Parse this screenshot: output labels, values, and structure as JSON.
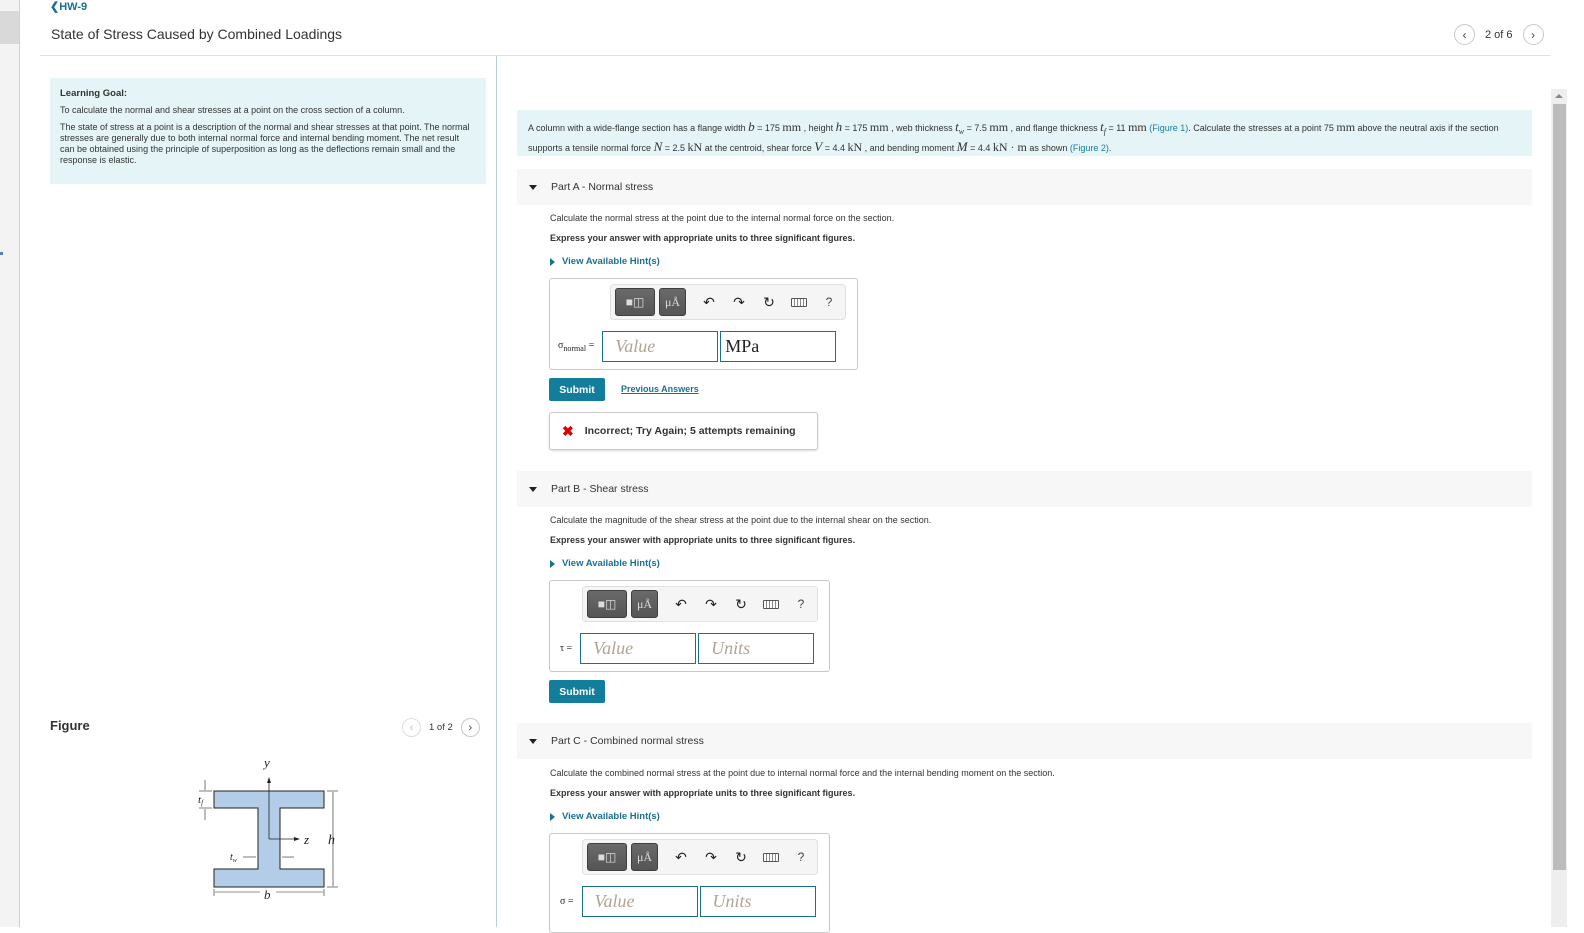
{
  "header": {
    "back_label": "HW-9",
    "title": "State of Stress Caused by Combined Loadings",
    "pager": {
      "text": "2 of 6",
      "prev_icon": "chevron-left-icon",
      "next_icon": "chevron-right-icon"
    }
  },
  "learning_goal": {
    "title": "Learning Goal:",
    "paragraphs": [
      "To calculate the normal and shear stresses at a point on the cross section of a column.",
      "The state of stress at a point is a description of the normal and shear stresses at that point. The normal stresses are generally due to both internal normal force and internal bending moment. The net result can be obtained using the principle of superposition as long as the deflections remain small and the response is elastic."
    ]
  },
  "figure": {
    "title": "Figure",
    "pager_text": "1 of 2",
    "labels": {
      "y": "y",
      "z": "z",
      "h": "h",
      "b": "b",
      "tf": "t",
      "tf_sub": "f",
      "tw": "t",
      "tw_sub": "w"
    },
    "colors": {
      "fill": "#b3cde8",
      "stroke": "#222222"
    }
  },
  "problem": {
    "t1": "A column with a wide-flange section has a flange width ",
    "b_var": "b",
    "t2": " = 175 ",
    "u_mm": "mm",
    "t3": " , height ",
    "h_var": "h",
    "t4": " = 175 ",
    "t5": " , web thickness ",
    "tw_var": "t",
    "tw_sub": "w",
    "t6": " = 7.5 ",
    "t7": " , and flange thickness ",
    "tf_var": "t",
    "tf_sub": "f",
    "t8": " = 11 ",
    "fig1": "(Figure 1)",
    "t9": ". Calculate the stresses at a point 75 ",
    "t10": " above the neutral axis if the section supports a tensile normal force ",
    "N_var": "N",
    "t11": " = 2.5 ",
    "u_kN": "kN",
    "t12": " at the centroid, shear force ",
    "V_var": "V",
    "t13": " = 4.4 ",
    "t14": " , and bending moment ",
    "M_var": "M",
    "t15": " = 4.4 ",
    "u_kNm": "kN · m",
    "t16": " as shown ",
    "fig2": "(Figure 2)",
    "t17": "."
  },
  "toolbar": {
    "mu_label": "μÅ",
    "undo": "↶",
    "redo": "↷",
    "reset": "↻",
    "help": "?"
  },
  "parts": [
    {
      "title": "Part A - Normal stress",
      "instruction": "Calculate the normal stress at the point due to the internal normal force on the section.",
      "express": "Express your answer with appropriate units to three significant figures.",
      "hint": "View Available Hint(s)",
      "var_label": "σ",
      "var_sub": "normal",
      "eq": " =",
      "value_placeholder": "Value",
      "units_value": "MPa",
      "submit": "Submit",
      "previous_answers": "Previous Answers",
      "feedback": "Incorrect; Try Again; 5 attempts remaining"
    },
    {
      "title": "Part B - Shear stress",
      "instruction": "Calculate the magnitude of the shear stress at the point due to the internal shear on the section.",
      "express": "Express your answer with appropriate units to three significant figures.",
      "hint": "View Available Hint(s)",
      "var_label": "τ",
      "eq": " =",
      "value_placeholder": "Value",
      "units_placeholder": "Units",
      "submit": "Submit"
    },
    {
      "title": "Part C - Combined normal stress",
      "instruction": "Calculate the combined normal stress at the point due to internal normal force and the internal bending moment on the section.",
      "express": "Express your answer with appropriate units to three significant figures.",
      "hint": "View Available Hint(s)",
      "var_label": "σ",
      "eq": " =",
      "value_placeholder": "Value",
      "units_placeholder": "Units"
    }
  ]
}
